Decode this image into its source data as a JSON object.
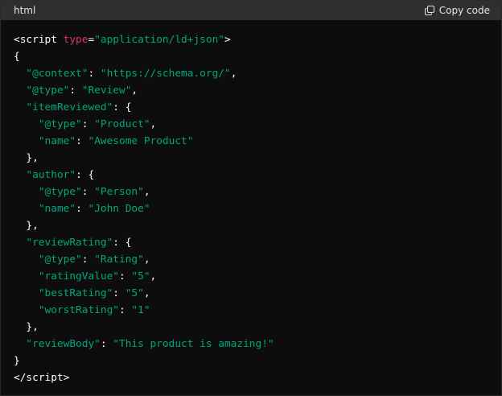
{
  "header": {
    "language": "html",
    "copy_label": "Copy code",
    "copy_icon": "copy-icon"
  },
  "colors": {
    "background": "#0d0d0d",
    "header_background": "#2f2f2f",
    "string": "#00a67d",
    "attribute": "#df3079",
    "text": "#ffffff"
  },
  "code": {
    "lines": [
      {
        "indent": "",
        "segments": [
          {
            "t": "plain",
            "v": "<script "
          },
          {
            "t": "attr",
            "v": "type"
          },
          {
            "t": "plain",
            "v": "="
          },
          {
            "t": "str",
            "v": "\"application/ld+json\""
          },
          {
            "t": "plain",
            "v": ">"
          }
        ]
      },
      {
        "indent": "",
        "segments": [
          {
            "t": "plain",
            "v": "{"
          }
        ]
      },
      {
        "indent": "  ",
        "segments": [
          {
            "t": "key",
            "v": "\"@context\""
          },
          {
            "t": "plain",
            "v": ": "
          },
          {
            "t": "str",
            "v": "\"https://schema.org/\""
          },
          {
            "t": "plain",
            "v": ","
          }
        ]
      },
      {
        "indent": "  ",
        "segments": [
          {
            "t": "key",
            "v": "\"@type\""
          },
          {
            "t": "plain",
            "v": ": "
          },
          {
            "t": "str",
            "v": "\"Review\""
          },
          {
            "t": "plain",
            "v": ","
          }
        ]
      },
      {
        "indent": "  ",
        "segments": [
          {
            "t": "key",
            "v": "\"itemReviewed\""
          },
          {
            "t": "plain",
            "v": ": {"
          }
        ]
      },
      {
        "indent": "    ",
        "segments": [
          {
            "t": "key",
            "v": "\"@type\""
          },
          {
            "t": "plain",
            "v": ": "
          },
          {
            "t": "str",
            "v": "\"Product\""
          },
          {
            "t": "plain",
            "v": ","
          }
        ]
      },
      {
        "indent": "    ",
        "segments": [
          {
            "t": "key",
            "v": "\"name\""
          },
          {
            "t": "plain",
            "v": ": "
          },
          {
            "t": "str",
            "v": "\"Awesome Product\""
          }
        ]
      },
      {
        "indent": "  ",
        "segments": [
          {
            "t": "plain",
            "v": "},"
          }
        ]
      },
      {
        "indent": "  ",
        "segments": [
          {
            "t": "key",
            "v": "\"author\""
          },
          {
            "t": "plain",
            "v": ": {"
          }
        ]
      },
      {
        "indent": "    ",
        "segments": [
          {
            "t": "key",
            "v": "\"@type\""
          },
          {
            "t": "plain",
            "v": ": "
          },
          {
            "t": "str",
            "v": "\"Person\""
          },
          {
            "t": "plain",
            "v": ","
          }
        ]
      },
      {
        "indent": "    ",
        "segments": [
          {
            "t": "key",
            "v": "\"name\""
          },
          {
            "t": "plain",
            "v": ": "
          },
          {
            "t": "str",
            "v": "\"John Doe\""
          }
        ]
      },
      {
        "indent": "  ",
        "segments": [
          {
            "t": "plain",
            "v": "},"
          }
        ]
      },
      {
        "indent": "  ",
        "segments": [
          {
            "t": "key",
            "v": "\"reviewRating\""
          },
          {
            "t": "plain",
            "v": ": {"
          }
        ]
      },
      {
        "indent": "    ",
        "segments": [
          {
            "t": "key",
            "v": "\"@type\""
          },
          {
            "t": "plain",
            "v": ": "
          },
          {
            "t": "str",
            "v": "\"Rating\""
          },
          {
            "t": "plain",
            "v": ","
          }
        ]
      },
      {
        "indent": "    ",
        "segments": [
          {
            "t": "key",
            "v": "\"ratingValue\""
          },
          {
            "t": "plain",
            "v": ": "
          },
          {
            "t": "str",
            "v": "\"5\""
          },
          {
            "t": "plain",
            "v": ","
          }
        ]
      },
      {
        "indent": "    ",
        "segments": [
          {
            "t": "key",
            "v": "\"bestRating\""
          },
          {
            "t": "plain",
            "v": ": "
          },
          {
            "t": "str",
            "v": "\"5\""
          },
          {
            "t": "plain",
            "v": ","
          }
        ]
      },
      {
        "indent": "    ",
        "segments": [
          {
            "t": "key",
            "v": "\"worstRating\""
          },
          {
            "t": "plain",
            "v": ": "
          },
          {
            "t": "str",
            "v": "\"1\""
          }
        ]
      },
      {
        "indent": "  ",
        "segments": [
          {
            "t": "plain",
            "v": "},"
          }
        ]
      },
      {
        "indent": "  ",
        "segments": [
          {
            "t": "key",
            "v": "\"reviewBody\""
          },
          {
            "t": "plain",
            "v": ": "
          },
          {
            "t": "str",
            "v": "\"This product is amazing!\""
          }
        ]
      },
      {
        "indent": "",
        "segments": [
          {
            "t": "plain",
            "v": "}"
          }
        ]
      },
      {
        "indent": "",
        "segments": [
          {
            "t": "plain",
            "v": "</"
          },
          {
            "t": "plain",
            "v": "script>"
          }
        ]
      }
    ]
  }
}
